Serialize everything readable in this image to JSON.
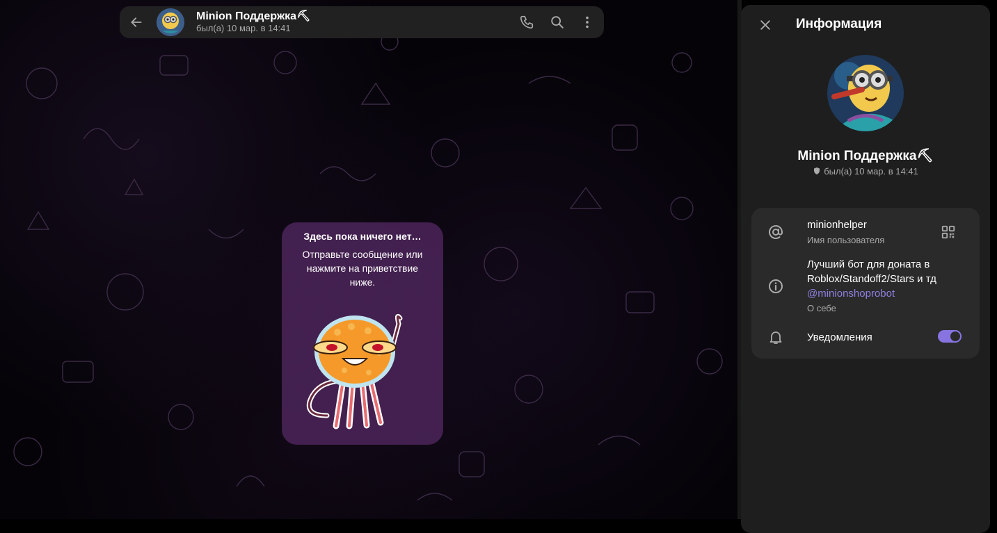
{
  "header": {
    "name": "Minion Поддержка⛏",
    "status": "был(а) 10 мар. в 14:41"
  },
  "empty_state": {
    "title": "Здесь пока ничего нет…",
    "text": "Отправьте сообщение или нажмите на приветствие ниже."
  },
  "panel": {
    "title": "Информация",
    "name": "Minion Поддержка⛏",
    "status": "был(а) 10 мар. в 14:41",
    "username": "minionhelper",
    "username_label": "Имя пользователя",
    "bio_line1": "Лучший бот для доната в",
    "bio_line2": "Roblox/Standoff2/Stars и тд",
    "bio_link": "@minionshoprobot",
    "bio_label": "О себе",
    "notifications_label": "Уведомления",
    "notifications_on": true
  },
  "colors": {
    "accent": "#8774e1",
    "link": "#8f7fe0",
    "panel_bg": "#1e1e1e",
    "card_bg": "#2a2a2a",
    "header_bg": "#212121",
    "empty_card_bg": "#4a2358"
  },
  "icons": [
    "back-arrow-icon",
    "phone-icon",
    "search-icon",
    "more-vertical-icon",
    "close-icon",
    "at-icon",
    "qr-code-icon",
    "info-icon",
    "bell-icon",
    "shield-icon"
  ]
}
